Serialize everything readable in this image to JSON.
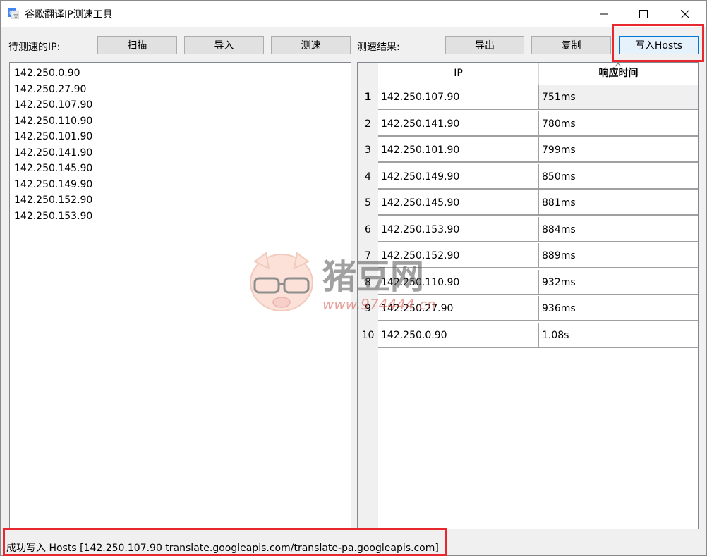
{
  "window": {
    "title": "谷歌翻译IP测速工具",
    "icon": "google-translate-icon"
  },
  "toolbar": {
    "pending_label": "待测速的IP:",
    "scan": "扫描",
    "import": "导入",
    "test": "测速",
    "results_label": "测速结果:",
    "export": "导出",
    "copy": "复制",
    "write_hosts": "写入Hosts"
  },
  "pending_ips": [
    "142.250.0.90",
    "142.250.27.90",
    "142.250.107.90",
    "142.250.110.90",
    "142.250.101.90",
    "142.250.141.90",
    "142.250.145.90",
    "142.250.149.90",
    "142.250.152.90",
    "142.250.153.90"
  ],
  "results": {
    "columns": [
      "IP",
      "响应时间"
    ],
    "rows": [
      {
        "n": "1",
        "ip": "142.250.107.90",
        "time": "751ms"
      },
      {
        "n": "2",
        "ip": "142.250.141.90",
        "time": "780ms"
      },
      {
        "n": "3",
        "ip": "142.250.101.90",
        "time": "799ms"
      },
      {
        "n": "4",
        "ip": "142.250.149.90",
        "time": "850ms"
      },
      {
        "n": "5",
        "ip": "142.250.145.90",
        "time": "881ms"
      },
      {
        "n": "6",
        "ip": "142.250.153.90",
        "time": "884ms"
      },
      {
        "n": "7",
        "ip": "142.250.152.90",
        "time": "889ms"
      },
      {
        "n": "8",
        "ip": "142.250.110.90",
        "time": "932ms"
      },
      {
        "n": "9",
        "ip": "142.250.27.90",
        "time": "936ms"
      },
      {
        "n": "10",
        "ip": "142.250.0.90",
        "time": "1.08s"
      }
    ]
  },
  "status": "成功写入 Hosts [142.250.107.90 translate.googleapis.com/translate-pa.googleapis.com]",
  "watermark": {
    "brand": "猪豆网",
    "url": "www.974444.cn"
  },
  "colors": {
    "highlight": "#e8282f",
    "button_active_border": "#0078d7"
  }
}
